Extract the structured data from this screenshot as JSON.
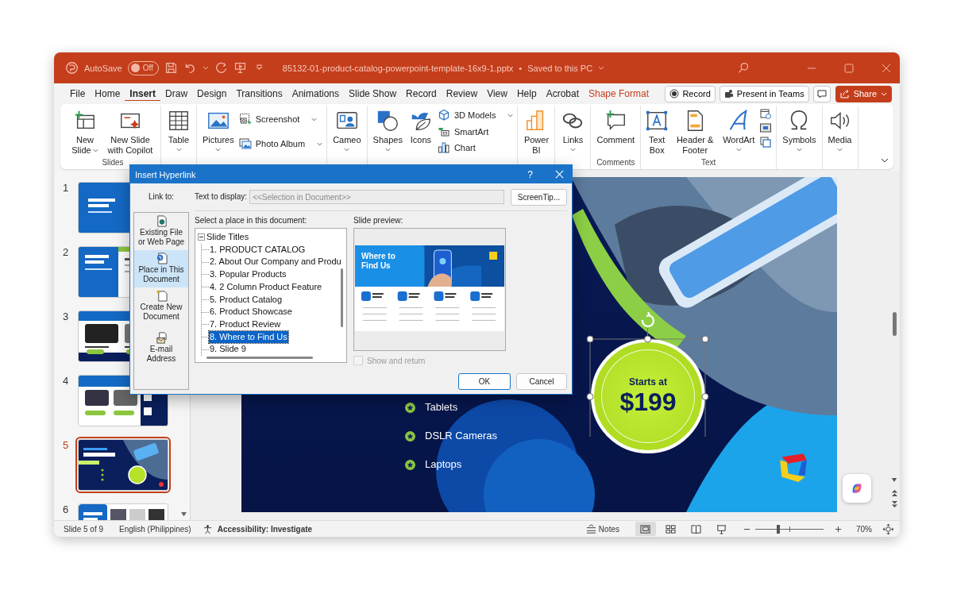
{
  "title_bar": {
    "autosave_label": "AutoSave",
    "autosave": {
      "on": false,
      "label": "Off"
    },
    "file_name": "85132-01-product-catalog-powerpoint-template-16x9-1.pptx",
    "separator": "•",
    "save_status": "Saved to this PC"
  },
  "tabs": [
    {
      "label": "File",
      "selected": false,
      "kind": "normal"
    },
    {
      "label": "Home",
      "selected": false,
      "kind": "normal"
    },
    {
      "label": "Insert",
      "selected": true,
      "kind": "normal"
    },
    {
      "label": "Draw",
      "selected": false,
      "kind": "normal"
    },
    {
      "label": "Design",
      "selected": false,
      "kind": "normal"
    },
    {
      "label": "Transitions",
      "selected": false,
      "kind": "normal"
    },
    {
      "label": "Animations",
      "selected": false,
      "kind": "normal"
    },
    {
      "label": "Slide Show",
      "selected": false,
      "kind": "normal"
    },
    {
      "label": "Record",
      "selected": false,
      "kind": "normal"
    },
    {
      "label": "Review",
      "selected": false,
      "kind": "normal"
    },
    {
      "label": "View",
      "selected": false,
      "kind": "normal"
    },
    {
      "label": "Help",
      "selected": false,
      "kind": "normal"
    },
    {
      "label": "Acrobat",
      "selected": false,
      "kind": "normal"
    },
    {
      "label": "Shape Format",
      "selected": false,
      "kind": "contextual"
    }
  ],
  "tab_buttons": {
    "record": "Record",
    "present": "Present in Teams",
    "share": "Share"
  },
  "ribbon": {
    "groups": [
      {
        "label": "Slides",
        "items": [
          {
            "kind": "large",
            "label": "New Slide",
            "dropdown": true
          },
          {
            "kind": "large",
            "label": "New Slide with Copilot",
            "dropdown": false
          }
        ]
      },
      {
        "items": [
          {
            "kind": "large",
            "label": "Table",
            "dropdown": true
          }
        ]
      },
      {
        "items": [
          {
            "kind": "large",
            "label": "Pictures",
            "dropdown": true
          },
          {
            "kind": "stack",
            "rows": [
              {
                "label": "Screenshot",
                "dropdown": true
              },
              {
                "label": "Photo Album",
                "dropdown": true
              }
            ]
          }
        ]
      },
      {
        "items": [
          {
            "kind": "large",
            "label": "Cameo",
            "dropdown": true
          }
        ]
      },
      {
        "items": [
          {
            "kind": "large",
            "label": "Shapes",
            "dropdown": true
          },
          {
            "kind": "large",
            "label": "Icons",
            "dropdown": false
          },
          {
            "kind": "stack",
            "rows": [
              {
                "label": "3D Models",
                "dropdown": true
              },
              {
                "label": "SmartArt",
                "dropdown": false
              },
              {
                "label": "Chart",
                "dropdown": false
              }
            ]
          }
        ]
      },
      {
        "items": [
          {
            "kind": "large",
            "label": "Power BI",
            "dropdown": false
          }
        ]
      },
      {
        "items": [
          {
            "kind": "large",
            "label": "Links",
            "dropdown": true
          }
        ]
      },
      {
        "label": "Comments",
        "items": [
          {
            "kind": "large",
            "label": "Comment",
            "dropdown": false
          }
        ]
      },
      {
        "label": "Text",
        "items": [
          {
            "kind": "large",
            "label": "Text Box",
            "dropdown": false
          },
          {
            "kind": "large",
            "label": "Header & Footer",
            "dropdown": false
          },
          {
            "kind": "large",
            "label": "WordArt",
            "dropdown": true
          },
          {
            "kind": "icon_column"
          }
        ]
      },
      {
        "items": [
          {
            "kind": "large",
            "label": "Symbols",
            "dropdown": true
          }
        ]
      },
      {
        "items": [
          {
            "kind": "large",
            "label": "Media",
            "dropdown": true
          }
        ]
      }
    ]
  },
  "slides": [
    {
      "number": "1",
      "selected": false
    },
    {
      "number": "2",
      "selected": false
    },
    {
      "number": "3",
      "selected": false
    },
    {
      "number": "4",
      "selected": false
    },
    {
      "number": "5",
      "selected": true
    },
    {
      "number": "6",
      "selected": false
    }
  ],
  "slide": {
    "bullets": [
      "Tablets",
      "DSLR Cameras",
      "Laptops"
    ],
    "badge": {
      "caption": "Starts at",
      "price": "$199"
    }
  },
  "dialog": {
    "title": "Insert Hyperlink",
    "help": "?",
    "link_to_label": "Link to:",
    "link_options": [
      {
        "label": "Existing File or Web Page",
        "selected": false
      },
      {
        "label": "Place in This Document",
        "selected": true
      },
      {
        "label": "Create New Document",
        "selected": false
      },
      {
        "label": "E-mail Address",
        "selected": false
      }
    ],
    "text_to_display_label": "Text to display:",
    "text_to_display": {
      "value": "<<Selection in Document>>",
      "disabled": true
    },
    "screentip_button": "ScreenTip...",
    "place_label": "Select a place in this document:",
    "tree": [
      {
        "label": "Slide Titles",
        "expanded": true,
        "children": [
          {
            "label": "1. PRODUCT CATALOG",
            "selected": false
          },
          {
            "label": "2. About Our Company and Produ",
            "selected": false
          },
          {
            "label": "3. Popular Products",
            "selected": false
          },
          {
            "label": "4. 2 Column Product Feature",
            "selected": false
          },
          {
            "label": "5. Product Catalog",
            "selected": false
          },
          {
            "label": "6. Product Showcase",
            "selected": false
          },
          {
            "label": "7. Product Review",
            "selected": false
          },
          {
            "label": "8. Where to  Find Us",
            "selected": true
          },
          {
            "label": "9. Slide 9",
            "selected": false
          }
        ]
      }
    ],
    "preview_label": "Slide preview:",
    "preview_title": "Where to Find Us",
    "show_and_return": {
      "label": "Show and return",
      "checked": false,
      "disabled": true
    },
    "ok": "OK",
    "cancel": "Cancel"
  },
  "status_bar": {
    "slide_info": "Slide 5 of 9",
    "language": "English (Philippines)",
    "accessibility": "Accessibility: Investigate",
    "notes": "Notes",
    "views": [
      {
        "selected": true
      },
      {
        "selected": false
      },
      {
        "selected": false
      },
      {
        "selected": false
      }
    ],
    "zoom": {
      "level": 0.34
    },
    "zoom_label": "70%"
  }
}
